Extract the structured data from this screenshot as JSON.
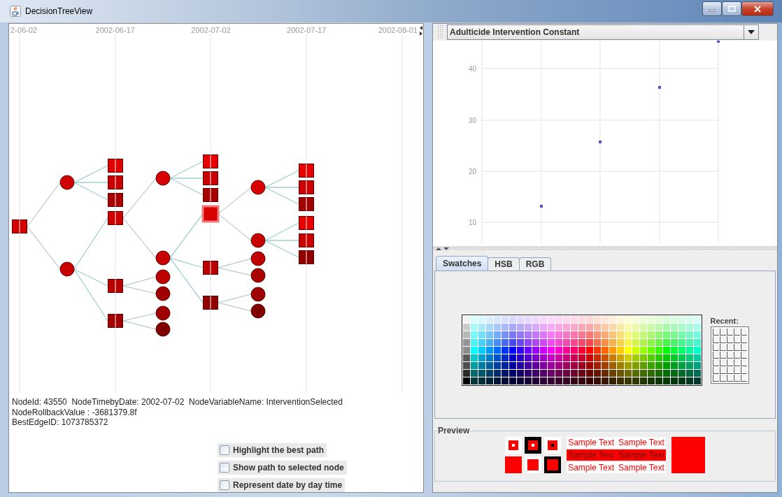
{
  "window": {
    "title": "DecisionTreeView"
  },
  "timeline": {
    "dates": [
      "2-06-02",
      "2002-06-17",
      "2002-07-02",
      "2002-07-17",
      "2002-08-01"
    ]
  },
  "tree": {
    "kind": "decision",
    "selected": false,
    "color": "#d40000",
    "children": [
      {
        "kind": "chance",
        "selected": false,
        "color": "#d00000",
        "children": [
          {
            "kind": "decision",
            "selected": false,
            "color": "#e00000"
          },
          {
            "kind": "decision",
            "selected": false,
            "color": "#c80000"
          },
          {
            "kind": "decision",
            "selected": false,
            "color": "#a80000"
          }
        ]
      },
      {
        "kind": "chance",
        "selected": false,
        "color": "#c80000",
        "children": [
          {
            "kind": "decision",
            "selected": false,
            "color": "#d00000",
            "children": [
              {
                "kind": "chance",
                "selected": false,
                "color": "#d80000",
                "children": [
                  {
                    "kind": "decision",
                    "selected": false,
                    "color": "#e80000"
                  },
                  {
                    "kind": "decision",
                    "selected": false,
                    "color": "#cc0000"
                  },
                  {
                    "kind": "decision",
                    "selected": false,
                    "color": "#a80000"
                  }
                ]
              },
              {
                "kind": "chance",
                "selected": false,
                "color": "#c80000",
                "children": [
                  {
                    "kind": "decision",
                    "selected": true,
                    "color": "#d80000",
                    "children": [
                      {
                        "kind": "chance",
                        "selected": false,
                        "color": "#d80000",
                        "children": [
                          {
                            "kind": "decision",
                            "selected": false,
                            "color": "#e80000"
                          },
                          {
                            "kind": "decision",
                            "selected": false,
                            "color": "#cc0000"
                          },
                          {
                            "kind": "decision",
                            "selected": false,
                            "color": "#a00000"
                          }
                        ]
                      },
                      {
                        "kind": "chance",
                        "selected": false,
                        "color": "#c80000",
                        "children": [
                          {
                            "kind": "decision",
                            "selected": false,
                            "color": "#e80000"
                          },
                          {
                            "kind": "decision",
                            "selected": false,
                            "color": "#c80000"
                          },
                          {
                            "kind": "decision",
                            "selected": false,
                            "color": "#900000"
                          }
                        ]
                      }
                    ]
                  },
                  {
                    "kind": "decision",
                    "selected": false,
                    "color": "#b80000",
                    "children": [
                      {
                        "kind": "chance",
                        "selected": false,
                        "color": "#c00000"
                      },
                      {
                        "kind": "chance",
                        "selected": false,
                        "color": "#a80000"
                      }
                    ]
                  },
                  {
                    "kind": "decision",
                    "selected": false,
                    "color": "#900000",
                    "children": [
                      {
                        "kind": "chance",
                        "selected": false,
                        "color": "#a00000"
                      },
                      {
                        "kind": "chance",
                        "selected": false,
                        "color": "#800000"
                      }
                    ]
                  }
                ]
              }
            ]
          },
          {
            "kind": "decision",
            "selected": false,
            "color": "#b80000",
            "children": [
              {
                "kind": "chance",
                "selected": false,
                "color": "#c00000"
              },
              {
                "kind": "chance",
                "selected": false,
                "color": "#a00000"
              }
            ]
          },
          {
            "kind": "decision",
            "selected": false,
            "color": "#a00000",
            "children": [
              {
                "kind": "chance",
                "selected": false,
                "color": "#a00000"
              },
              {
                "kind": "chance",
                "selected": false,
                "color": "#800000"
              }
            ]
          }
        ]
      }
    ]
  },
  "node_info": [
    "NodeId: 43550  NodeTimebyDate: 2002-07-02  NodeVariableName: InterventionSelected",
    "NodeRollbackValue : -3681379.8f",
    "BestEdgeID: 1073785372"
  ],
  "options": [
    {
      "label": "Highlight the best path",
      "checked": false
    },
    {
      "label": "Show path to selected node",
      "checked": false
    },
    {
      "label": "Represent date by day time",
      "checked": false
    }
  ],
  "variable_select": {
    "value": "Adulticide Intervention Constant"
  },
  "plot": {
    "y_labels": [
      "40",
      "30",
      "20",
      "10"
    ]
  },
  "color_chooser": {
    "tabs": [
      {
        "label": "Swatches",
        "selected": true
      },
      {
        "label": "HSB",
        "selected": false
      },
      {
        "label": "RGB",
        "selected": false
      }
    ],
    "recent_label": "Recent:",
    "preview": {
      "title": "Preview",
      "color": "#ff0000",
      "sample_rows": [
        [
          "Sample Text",
          "Sample Text"
        ],
        [
          "Sample Text",
          "Sample Text"
        ],
        [
          "Sample Text",
          "Sample Text"
        ]
      ]
    }
  }
}
